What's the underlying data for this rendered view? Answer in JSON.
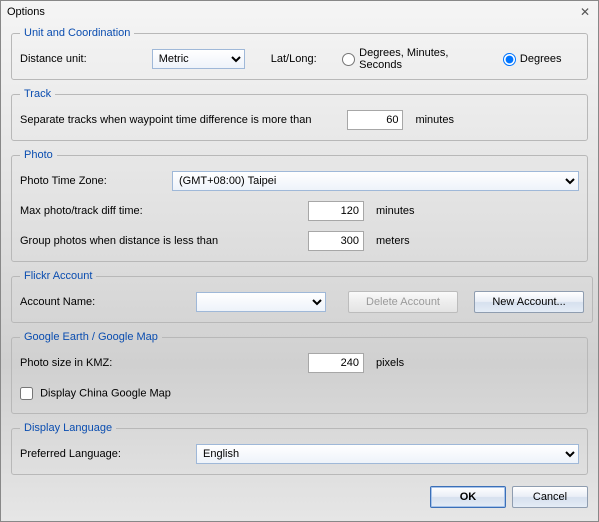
{
  "window": {
    "title": "Options"
  },
  "unit_coord": {
    "legend": "Unit and Coordination",
    "distance_unit_label": "Distance unit:",
    "distance_unit_value": "Metric",
    "latlong_label": "Lat/Long:",
    "radio_dms": "Degrees, Minutes, Seconds",
    "radio_deg": "Degrees",
    "latlong_selected": "deg"
  },
  "track": {
    "legend": "Track",
    "separate_label": "Separate tracks when waypoint time difference is more than",
    "separate_value": "60",
    "separate_unit": "minutes"
  },
  "photo": {
    "legend": "Photo",
    "tz_label": "Photo Time Zone:",
    "tz_value": "(GMT+08:00) Taipei",
    "diff_label": "Max photo/track diff time:",
    "diff_value": "120",
    "diff_unit": "minutes",
    "group_label": "Group photos when distance is less than",
    "group_value": "300",
    "group_unit": "meters"
  },
  "flickr": {
    "legend": "Flickr Account",
    "account_label": "Account Name:",
    "account_value": "",
    "delete_btn": "Delete Account",
    "new_btn": "New Account..."
  },
  "gearth": {
    "legend": "Google Earth / Google Map",
    "kmz_label": "Photo size in KMZ:",
    "kmz_value": "240",
    "kmz_unit": "pixels",
    "china_checkbox": "Display China Google Map",
    "china_checked": false
  },
  "lang": {
    "legend": "Display Language",
    "pref_label": "Preferred Language:",
    "pref_value": "English"
  },
  "footer": {
    "ok": "OK",
    "cancel": "Cancel"
  }
}
